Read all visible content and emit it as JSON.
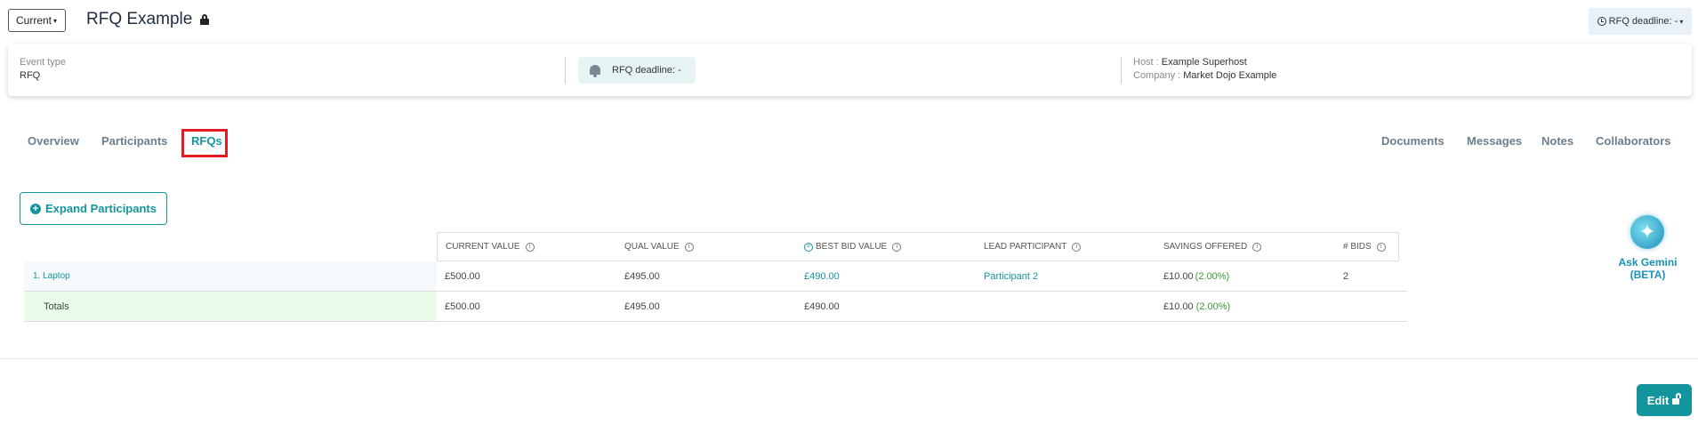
{
  "header": {
    "version_select": "Current",
    "title": "RFQ Example",
    "deadline_button": "RFQ deadline: -"
  },
  "info_card": {
    "event_type_label": "Event type",
    "event_type_value": "RFQ",
    "deadline": "RFQ deadline: -",
    "host_label": "Host : ",
    "host_value": "Example Superhost",
    "company_label": "Company : ",
    "company_value": "Market Dojo Example"
  },
  "tabs": {
    "left": [
      "Overview",
      "Participants",
      "RFQs"
    ],
    "right": [
      "Documents",
      "Messages",
      "Notes",
      "Collaborators"
    ],
    "active": "RFQs"
  },
  "expand_button": "Expand Participants",
  "table": {
    "columns": [
      "CURRENT VALUE",
      "QUAL VALUE",
      "BEST BID VALUE",
      "LEAD PARTICIPANT",
      "SAVINGS OFFERED",
      "# BIDS"
    ],
    "rows": [
      {
        "name": "1. Laptop",
        "current_value": "£500.00",
        "qual_value": "£495.00",
        "best_bid_value": "£490.00",
        "lead_participant": "Participant 2",
        "savings": "£10.00",
        "savings_pct": "(2.00%)",
        "bids": "2"
      },
      {
        "name": "Totals",
        "current_value": "£500.00",
        "qual_value": "£495.00",
        "best_bid_value": "£490.00",
        "lead_participant": "",
        "savings": "£10.00",
        "savings_pct": "(2.00%)",
        "bids": ""
      }
    ]
  },
  "gemini": {
    "label": "Ask Gemini (BETA)"
  },
  "edit_button": "Edit",
  "colors": {
    "accent": "#13959e",
    "highlight": "#e31b23",
    "savings_green": "#3a9a3a"
  },
  "icons": [
    "lock-icon",
    "clock-icon",
    "bell-icon",
    "plus-circle-icon",
    "info-icon",
    "equal-icon",
    "gemini-sparkle-icon",
    "unlock-icon"
  ]
}
